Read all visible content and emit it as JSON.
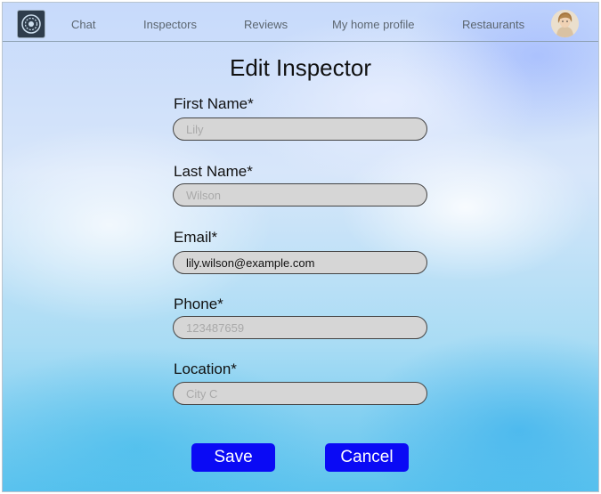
{
  "nav": {
    "links": [
      "Chat",
      "Inspectors",
      "Reviews",
      "My home profile",
      "Restaurants"
    ]
  },
  "page": {
    "title": "Edit Inspector"
  },
  "form": {
    "first_name": {
      "label": "First Name*",
      "value": "",
      "placeholder": "Lily"
    },
    "last_name": {
      "label": "Last Name*",
      "value": "",
      "placeholder": "Wilson"
    },
    "email": {
      "label": "Email*",
      "value": "lily.wilson@example.com",
      "placeholder": ""
    },
    "phone": {
      "label": "Phone*",
      "value": "",
      "placeholder": "123487659"
    },
    "location": {
      "label": "Location*",
      "value": "",
      "placeholder": "City C"
    }
  },
  "actions": {
    "save_label": "Save",
    "cancel_label": "Cancel"
  },
  "colors": {
    "button": "#0a0af5",
    "input_bg": "#d6d6d6"
  }
}
